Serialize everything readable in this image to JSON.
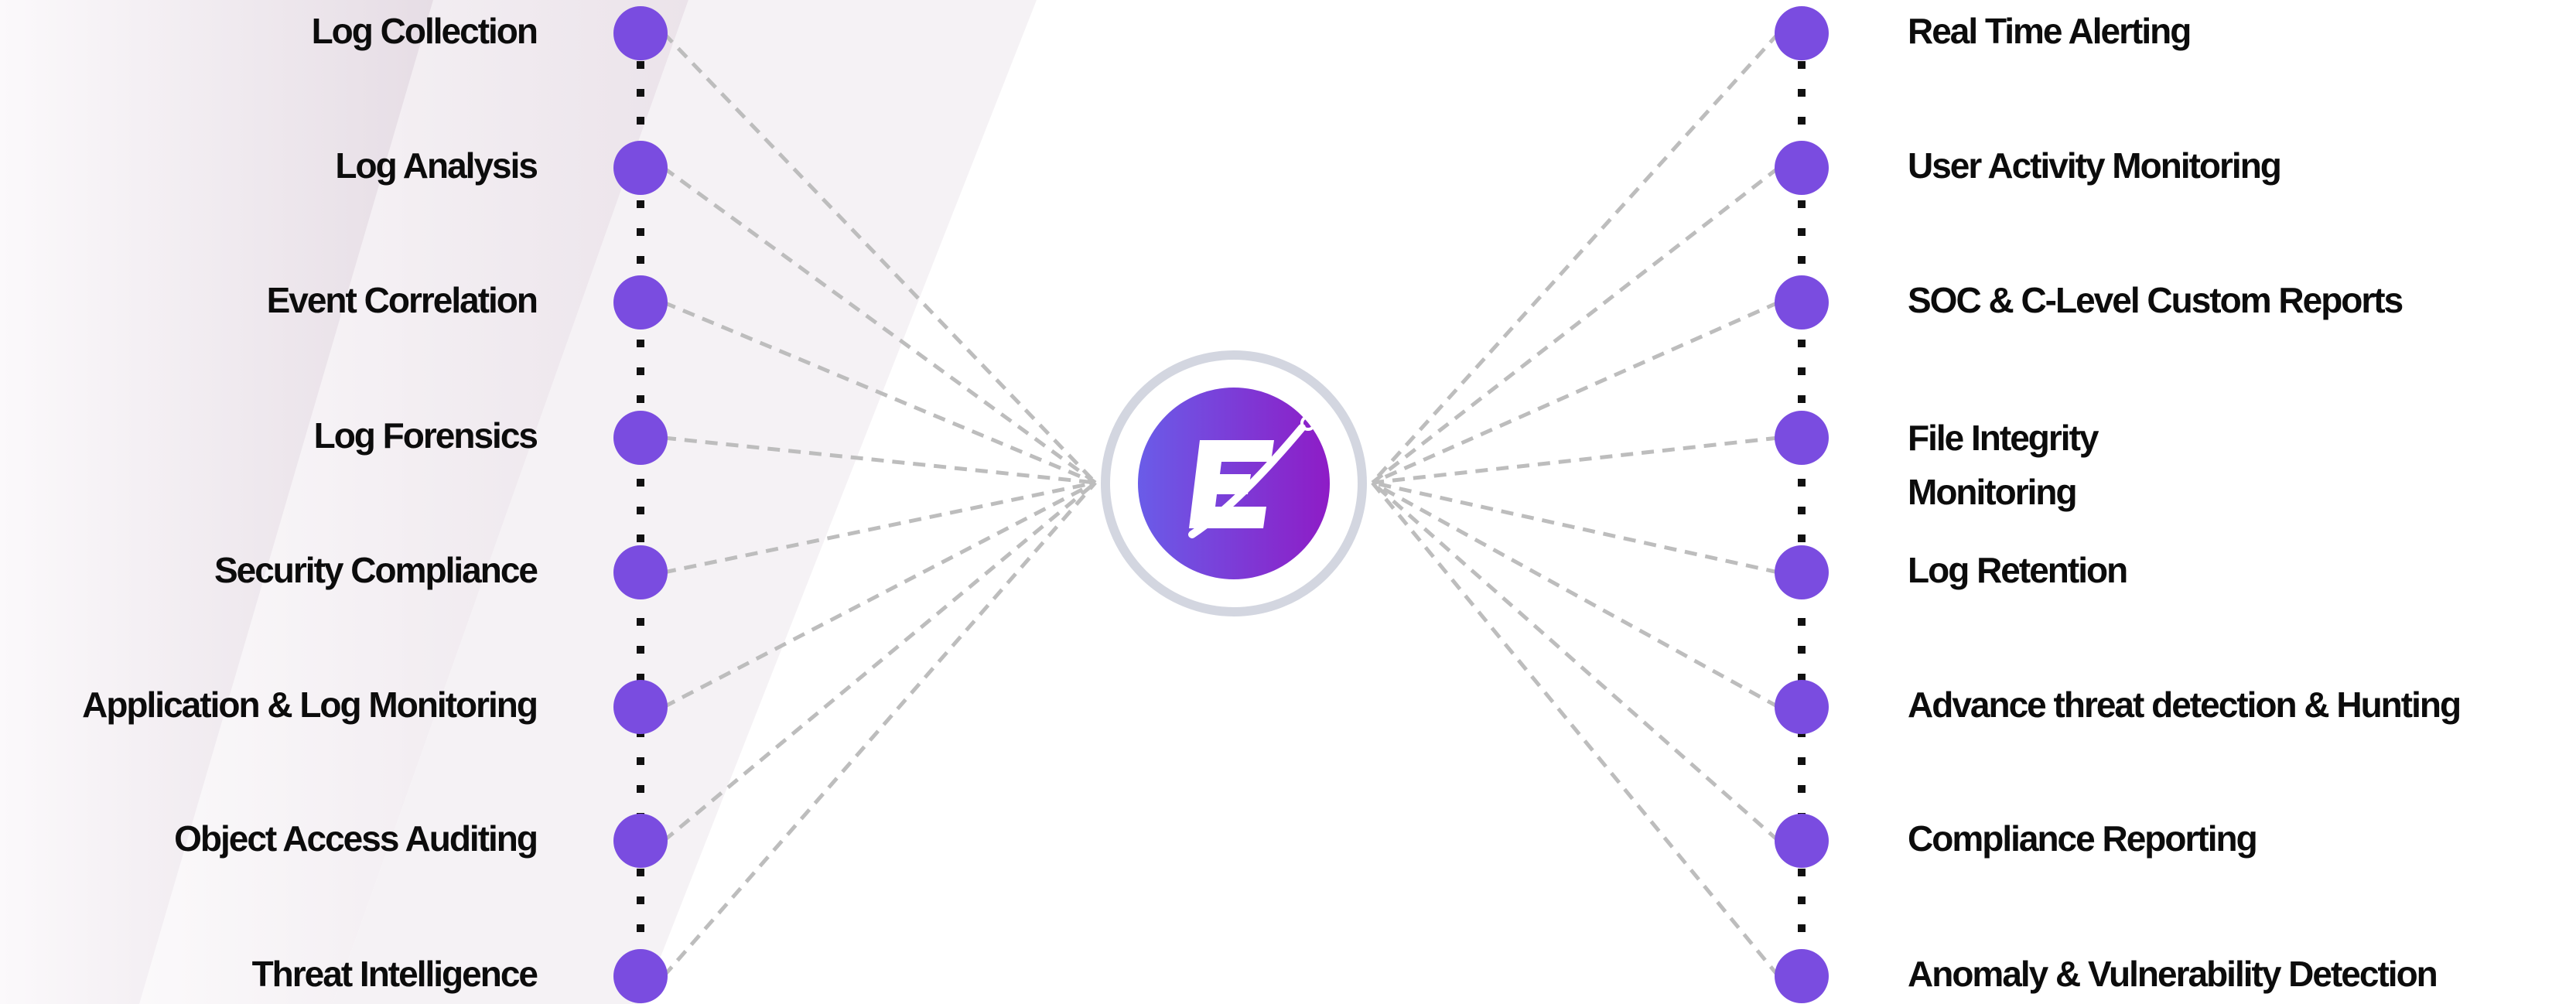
{
  "colors": {
    "node": "#7a4ce0",
    "connector": "#bdbdbd",
    "spine": "#111111",
    "hub_ring": "#d3d6e0",
    "hub_gradient_start": "#6a5ce8",
    "hub_gradient_end": "#8e1cc6",
    "background_band": "#ece6eb"
  },
  "hub": {
    "icon": "e-logo-icon"
  },
  "left_items": [
    {
      "label": "Log Collection"
    },
    {
      "label": "Log Analysis"
    },
    {
      "label": "Event Correlation"
    },
    {
      "label": "Log Forensics"
    },
    {
      "label": "Security Compliance"
    },
    {
      "label": "Application & Log Monitoring"
    },
    {
      "label": "Object Access Auditing"
    },
    {
      "label": "Threat Intelligence"
    }
  ],
  "right_items": [
    {
      "label": "Real Time Alerting"
    },
    {
      "label": "User Activity Monitoring"
    },
    {
      "label": "SOC & C-Level Custom Reports"
    },
    {
      "label": "File Integrity Monitoring"
    },
    {
      "label": "Log Retention"
    },
    {
      "label": "Advance threat detection & Hunting"
    },
    {
      "label": "Compliance Reporting"
    },
    {
      "label": "Anomaly & Vulnerability Detection"
    }
  ]
}
